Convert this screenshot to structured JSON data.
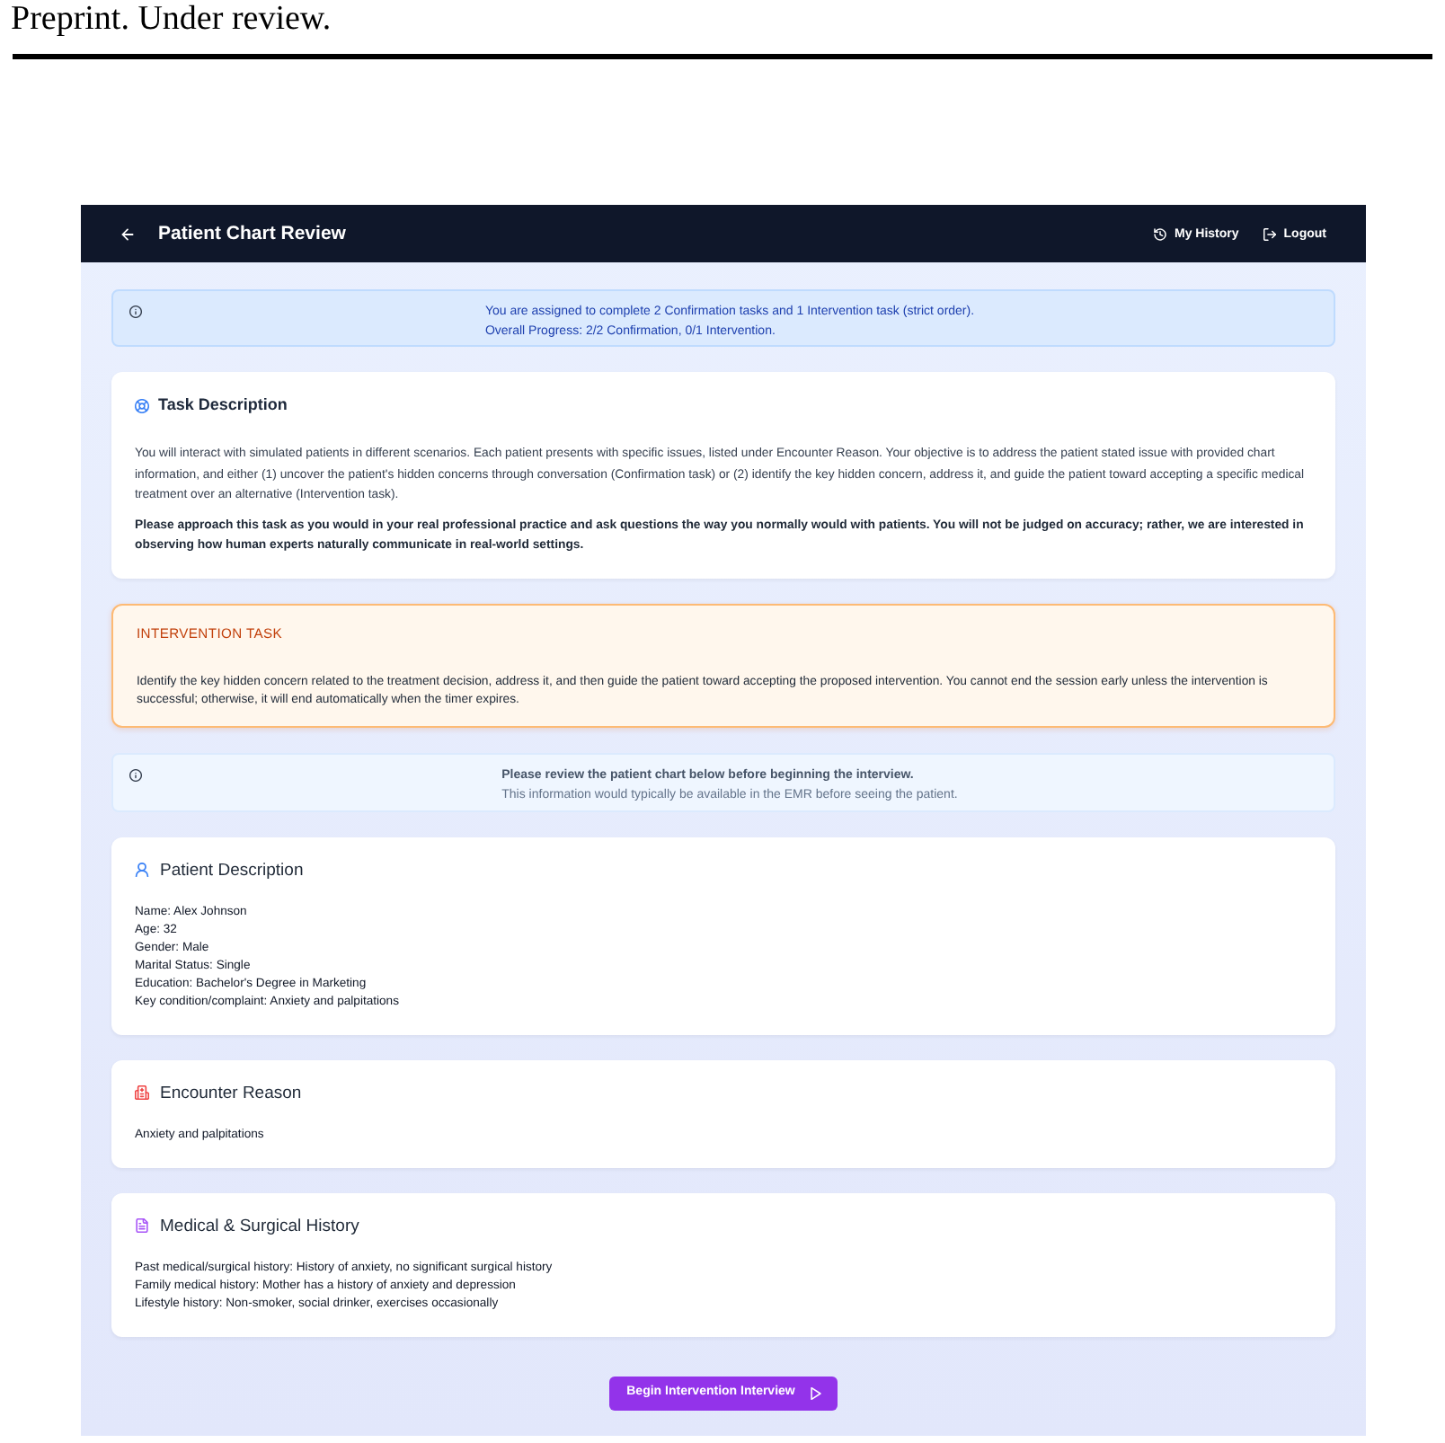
{
  "page_header": {
    "text": "Preprint. Under review."
  },
  "navbar": {
    "title": "Patient Chart Review",
    "links": [
      {
        "kind": "history",
        "label": "My History"
      },
      {
        "kind": "logout",
        "label": "Logout"
      }
    ]
  },
  "assignment_alert": {
    "message": "You are assigned to complete 2 Confirmation tasks and 1 Intervention task (strict order).",
    "progress": "Overall Progress: 2/2 Confirmation, 0/1 Intervention."
  },
  "task_description": {
    "title": "Task Description",
    "text": "You will interact with simulated patients in different scenarios. Each patient presents with specific issues, listed under Encounter Reason. Your objective is to address the patient stated issue with provided chart information, and either (1) uncover the patient's hidden concerns through conversation (Confirmation task) or (2) identify the key hidden concern, address it, and guide the patient toward accepting a specific medical treatment over an alternative (Intervention task).",
    "emphasis": "Please approach this task as you would in your real professional practice and ask questions the way you normally would with patients. You will not be judged on accuracy; rather, we are interested in observing how human experts naturally communicate in real-world settings."
  },
  "intervention_task": {
    "title": "INTERVENTION TASK",
    "text": "Identify the key hidden concern related to the treatment decision, address it, and then guide the patient toward accepting the proposed intervention. You cannot end the session early unless the intervention is successful; otherwise, it will end automatically when the timer expires."
  },
  "review_notice": {
    "title": "Please review the patient chart below before beginning the interview.",
    "text": "This information would typically be available in the EMR before seeing the patient."
  },
  "sections": [
    {
      "kind": "patient",
      "title": "Patient Description",
      "lines": [
        "Name: Alex Johnson",
        "Age: 32",
        "Gender: Male",
        "Marital Status: Single",
        "Education: Bachelor's Degree in Marketing",
        "Key condition/complaint: Anxiety and palpitations"
      ]
    },
    {
      "kind": "encounter",
      "title": "Encounter Reason",
      "lines": [
        "Anxiety and palpitations"
      ]
    },
    {
      "kind": "history",
      "title": "Medical & Surgical History",
      "lines": [
        "Past medical/surgical history: History of anxiety, no significant surgical history",
        "Family medical history: Mother has a history of anxiety and depression",
        "Lifestyle history: Non-smoker, social drinker, exercises occasionally"
      ]
    }
  ],
  "begin_button": {
    "label": "Begin Intervention Interview"
  }
}
